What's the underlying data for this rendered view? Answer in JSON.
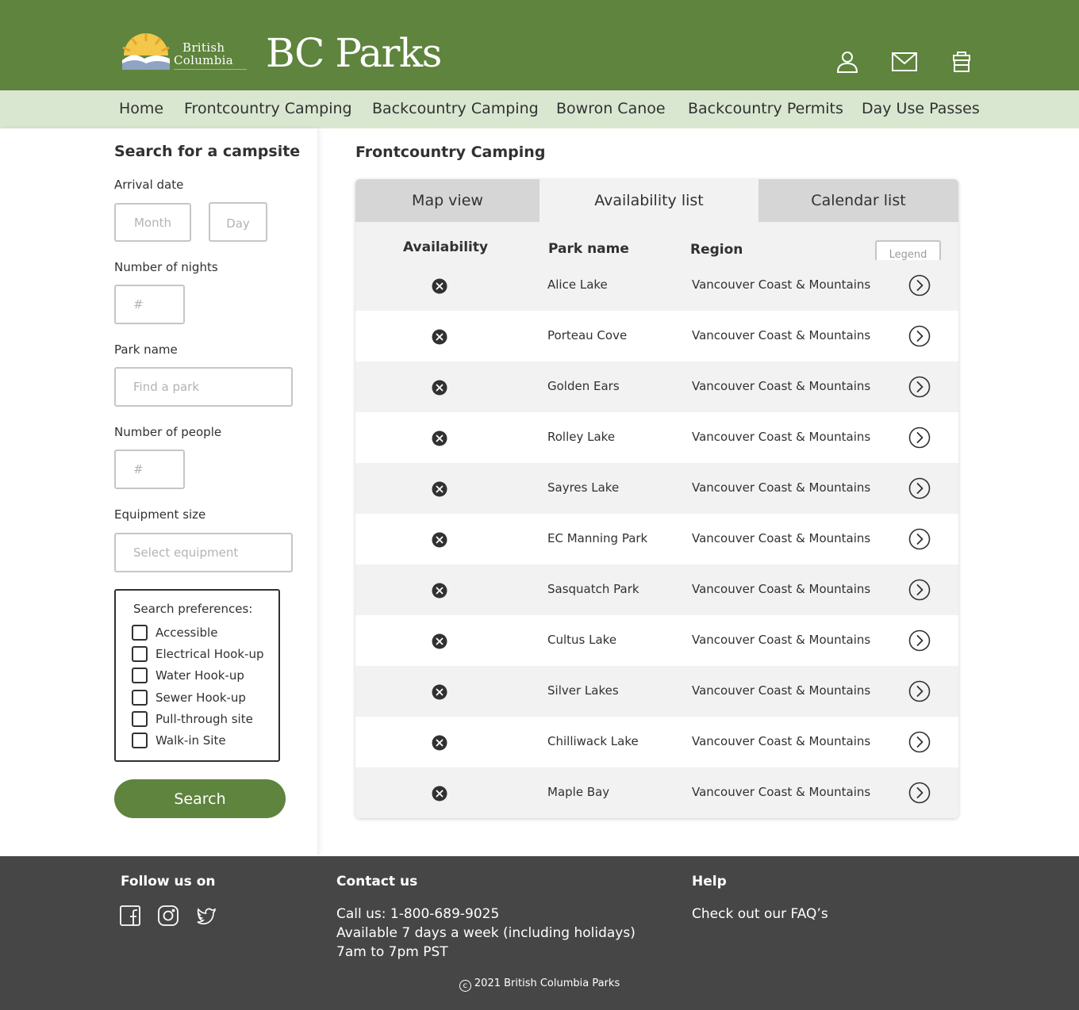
{
  "header": {
    "logo_line1": "British",
    "logo_line2": "Columbia",
    "brand": "BC Parks",
    "icons": [
      "user-icon",
      "mail-icon",
      "cart-icon"
    ]
  },
  "nav": {
    "items": [
      "Home",
      "Frontcountry Camping",
      "Backcountry Camping",
      "Bowron Canoe",
      "Backcountry Permits",
      "Day Use Passes"
    ]
  },
  "sidebar": {
    "title": "Search for a campsite",
    "arrival_label": "Arrival date",
    "month_placeholder": "Month",
    "day_placeholder": "Day",
    "nights_label": "Number of nights",
    "nights_placeholder": "#",
    "park_label": "Park name",
    "park_placeholder": "Find a park",
    "people_label": "Number of people",
    "people_placeholder": "#",
    "equipment_label": "Equipment size",
    "equipment_placeholder": "Select equipment",
    "prefs_title": "Search preferences:",
    "prefs": [
      "Accessible",
      "Electrical Hook-up",
      "Water Hook-up",
      "Sewer Hook-up",
      "Pull-through site",
      "Walk-in Site"
    ],
    "search_label": "Search"
  },
  "main": {
    "title": "Frontcountry Camping",
    "tabs": [
      {
        "label": "Map view",
        "active": false
      },
      {
        "label": "Availability list",
        "active": true
      },
      {
        "label": "Calendar list",
        "active": false
      }
    ],
    "columns": {
      "availability": "Availability",
      "park": "Park name",
      "region": "Region"
    },
    "legend_label": "Legend",
    "rows": [
      {
        "park": "Alice Lake",
        "region": "Vancouver Coast & Mountains",
        "availability": "unavailable"
      },
      {
        "park": "Porteau Cove",
        "region": "Vancouver Coast & Mountains",
        "availability": "unavailable"
      },
      {
        "park": "Golden Ears",
        "region": "Vancouver Coast & Mountains",
        "availability": "unavailable"
      },
      {
        "park": "Rolley Lake",
        "region": "Vancouver Coast & Mountains",
        "availability": "unavailable"
      },
      {
        "park": "Sayres Lake",
        "region": "Vancouver Coast & Mountains",
        "availability": "unavailable"
      },
      {
        "park": "EC Manning Park",
        "region": "Vancouver Coast & Mountains",
        "availability": "unavailable"
      },
      {
        "park": "Sasquatch Park",
        "region": "Vancouver Coast & Mountains",
        "availability": "unavailable"
      },
      {
        "park": "Cultus Lake",
        "region": "Vancouver Coast & Mountains",
        "availability": "unavailable"
      },
      {
        "park": "Silver Lakes",
        "region": "Vancouver Coast & Mountains",
        "availability": "unavailable"
      },
      {
        "park": "Chilliwack Lake",
        "region": "Vancouver Coast & Mountains",
        "availability": "unavailable"
      },
      {
        "park": "Maple Bay",
        "region": "Vancouver Coast & Mountains",
        "availability": "unavailable"
      }
    ]
  },
  "footer": {
    "follow_title": "Follow us on",
    "social_icons": [
      "facebook-icon",
      "instagram-icon",
      "twitter-icon"
    ],
    "contact_title": "Contact us",
    "contact_phone": "Call us: 1-800-689-9025",
    "contact_hours1": "Available 7 days a week (including holidays)",
    "contact_hours2": "7am to 7pm PST",
    "help_title": "Help",
    "help_link": "Check out our FAQ’s",
    "copyright": "2021 British Columbia Parks"
  },
  "colors": {
    "header_green": "#5e843d",
    "nav_light_green": "#d9e7d0",
    "footer_grey": "#464646",
    "accent_gold": "#e3a82b"
  }
}
